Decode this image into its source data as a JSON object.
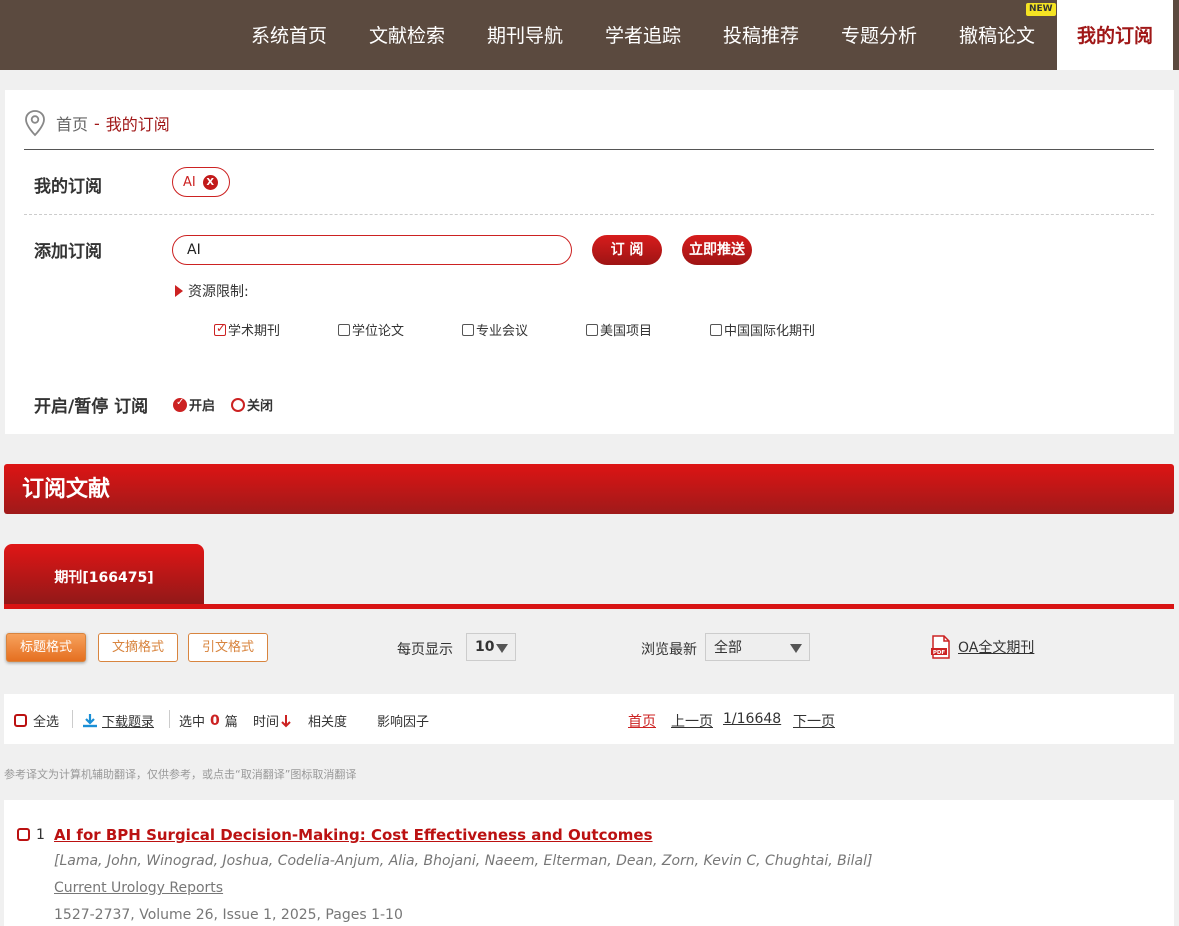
{
  "nav": {
    "items": [
      "系统首页",
      "文献检索",
      "期刊导航",
      "学者追踪",
      "投稿推荐",
      "专题分析",
      "撤稿论文",
      "我的订阅"
    ],
    "new_badge": "NEW",
    "active": "我的订阅"
  },
  "breadcrumb": {
    "home": "首页",
    "sep": "-",
    "current": "我的订阅"
  },
  "my_subscription": {
    "label": "我的订阅",
    "tags": [
      "AI"
    ]
  },
  "add_subscription": {
    "label": "添加订阅",
    "input_value": "AI",
    "subscribe_label": "订 阅",
    "push_label": "立即推送",
    "resource_label": "资源限制:",
    "resources": [
      {
        "label": "学术期刊",
        "checked": true
      },
      {
        "label": "学位论文",
        "checked": false
      },
      {
        "label": "专业会议",
        "checked": false
      },
      {
        "label": "美国项目",
        "checked": false
      },
      {
        "label": "中国国际化期刊",
        "checked": false
      }
    ]
  },
  "toggle": {
    "label": "开启/暂停 订阅",
    "on_label": "开启",
    "off_label": "关闭",
    "selected": "on"
  },
  "section": {
    "title": "订阅文献",
    "tab_label": "期刊[166475]"
  },
  "format": {
    "buttons": [
      "标题格式",
      "文摘格式",
      "引文格式"
    ],
    "active": "标题格式",
    "per_page_label": "每页显示",
    "per_page_value": "10",
    "browse_label": "浏览最新",
    "browse_value": "全部",
    "oa_label": "OA全文期刊"
  },
  "toolbar": {
    "select_all": "全选",
    "download": "下载题录",
    "selected_prefix": "选中",
    "selected_count": "0",
    "selected_suffix": "篇",
    "sort_time": "时间",
    "sort_relevance": "相关度",
    "sort_impact": "影响因子",
    "first_page": "首页",
    "prev_page": "上一页",
    "page_info": "1/16648",
    "next_page": "下一页"
  },
  "note": "参考译文为计算机辅助翻译，仅供参考，或点击“取消翻译”图标取消翻译",
  "results": [
    {
      "index": "1",
      "title": "AI for BPH Surgical Decision-Making: Cost Effectiveness and Outcomes",
      "authors": "[Lama, John, Winograd, Joshua, Codelia-Anjum, Alia, Bhojani, Naeem, Elterman, Dean, Zorn, Kevin C, Chughtai, Bilal]",
      "journal": "Current Urology Reports",
      "meta": "1527-2737, Volume 26, Issue 1, 2025, Pages 1-10"
    }
  ],
  "colors": {
    "nav_bg": "#5b4a3f",
    "accent_red": "#c21a1a",
    "orange": "#e56f20"
  }
}
